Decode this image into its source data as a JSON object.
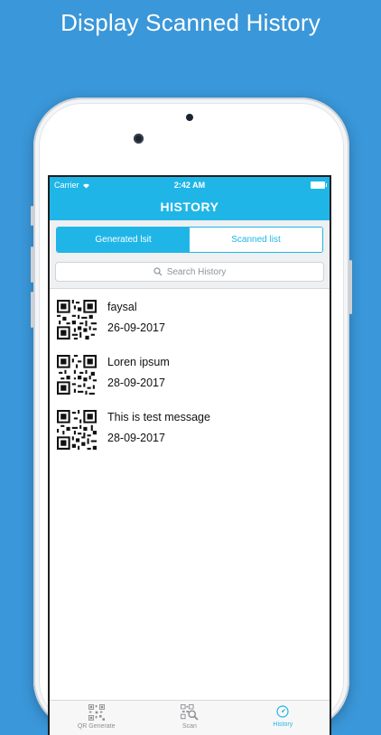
{
  "promo": {
    "title": "Display Scanned History"
  },
  "status_bar": {
    "carrier": "Carrier",
    "time": "2:42 AM"
  },
  "header": {
    "title": "HISTORY"
  },
  "segments": [
    {
      "label": "Generated lsit",
      "selected": true
    },
    {
      "label": "Scanned list",
      "selected": false
    }
  ],
  "search": {
    "placeholder": "Search History"
  },
  "history": [
    {
      "title": "faysal",
      "date": "26-09-2017"
    },
    {
      "title": "Loren ipsum",
      "date": "28-09-2017"
    },
    {
      "title": "This is test message",
      "date": "28-09-2017"
    }
  ],
  "tabs": [
    {
      "label": "QR Generate",
      "icon": "qr-icon",
      "active": false
    },
    {
      "label": "Scan",
      "icon": "scan-icon",
      "active": false
    },
    {
      "label": "History",
      "icon": "history-icon",
      "active": true
    }
  ],
  "colors": {
    "background": "#3a97d9",
    "accent": "#1fb6e7",
    "tab_inactive": "#8e8e93"
  }
}
